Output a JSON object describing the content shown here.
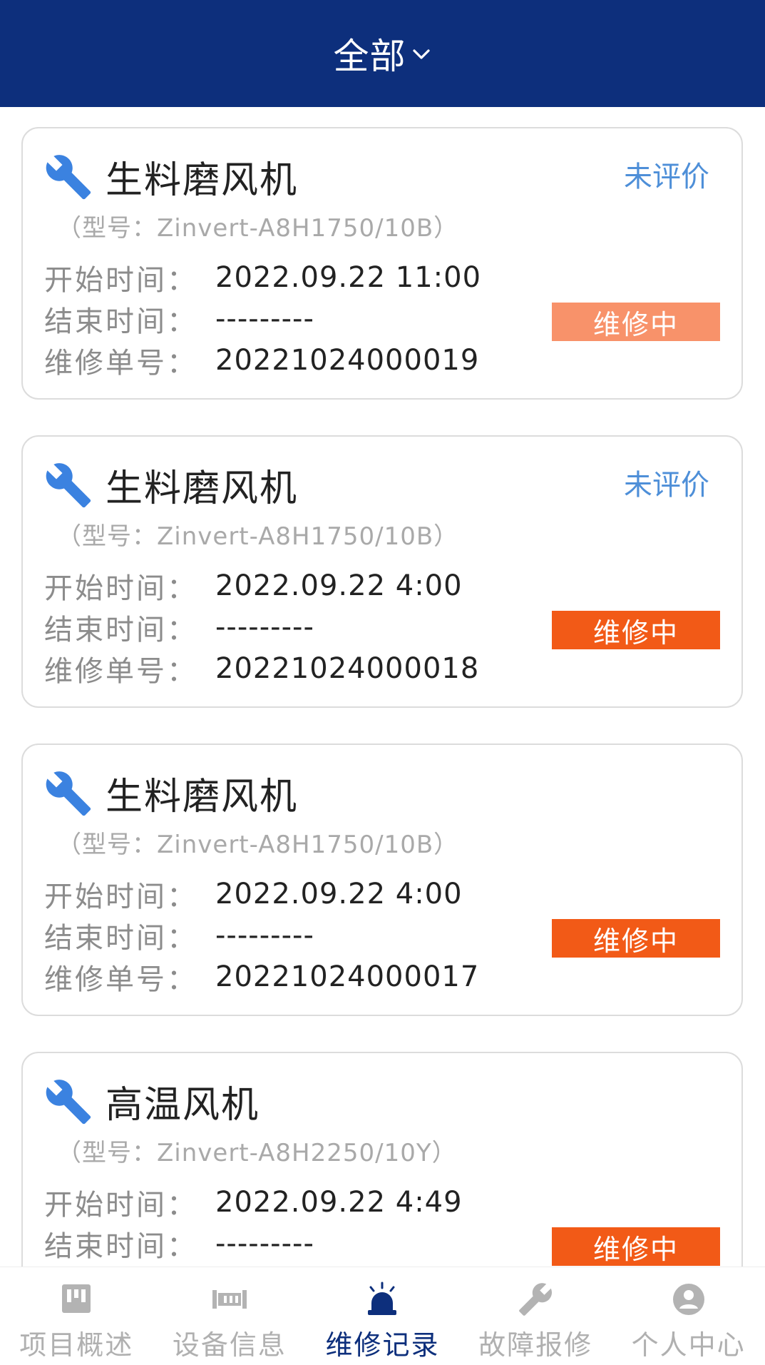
{
  "header": {
    "title": "全部"
  },
  "colors": {
    "header_bg": "#0d2f7c",
    "status_bg": "#f25a17",
    "rating_text": "#4e8fd8",
    "icon_blue": "#3b82e0",
    "tab_inactive": "#b0b0b0"
  },
  "labels": {
    "start": "开始时间：",
    "end": "结束时间：",
    "order": "维修单号："
  },
  "records": [
    {
      "name": "生料磨风机",
      "model": "（型号：Zinvert-A8H1750/10B）",
      "rating": "未评价",
      "start": "2022.09.22 11:00",
      "end": "---------",
      "order_no": "20221024000019",
      "status": "维修中"
    },
    {
      "name": "生料磨风机",
      "model": "（型号：Zinvert-A8H1750/10B）",
      "rating": "未评价",
      "start": "2022.09.22 4:00",
      "end": "---------",
      "order_no": "20221024000018",
      "status": "维修中"
    },
    {
      "name": "生料磨风机",
      "model": "（型号：Zinvert-A8H1750/10B）",
      "rating": "",
      "start": "2022.09.22 4:00",
      "end": "---------",
      "order_no": "20221024000017",
      "status": "维修中"
    },
    {
      "name": "高温风机",
      "model": "（型号：Zinvert-A8H2250/10Y）",
      "rating": "",
      "start": "2022.09.22 4:49",
      "end": "---------",
      "order_no": "",
      "status": "维修中"
    }
  ],
  "tabs": [
    {
      "label": "项目概述",
      "icon": "overview-icon"
    },
    {
      "label": "设备信息",
      "icon": "equipment-icon"
    },
    {
      "label": "维修记录",
      "icon": "alarm-light-icon",
      "active": true
    },
    {
      "label": "故障报修",
      "icon": "wrench-icon"
    },
    {
      "label": "个人中心",
      "icon": "user-icon"
    }
  ]
}
